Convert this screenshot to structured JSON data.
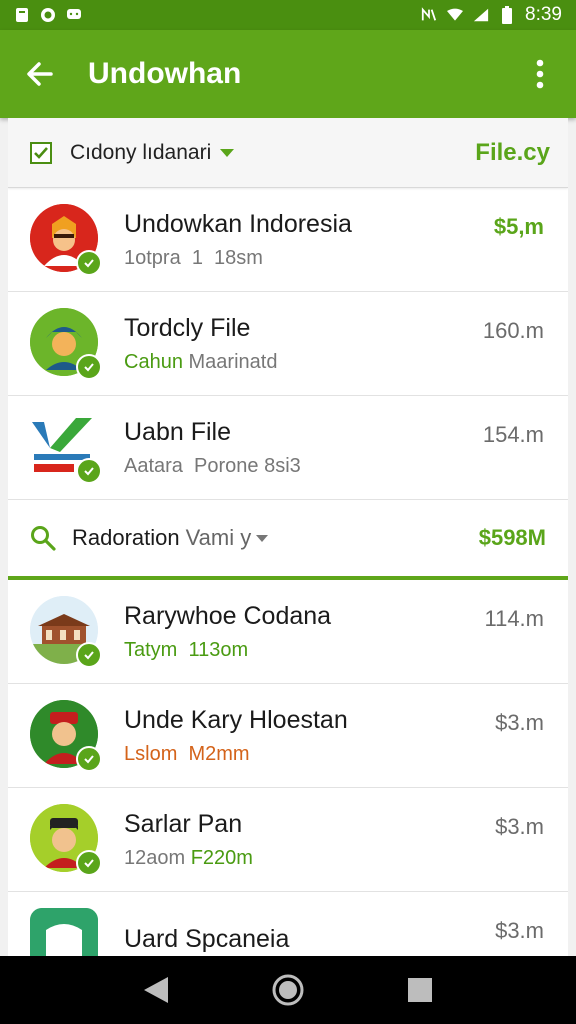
{
  "status_bar": {
    "time": "8:39",
    "left_icons": [
      "notification-icon",
      "whatsapp-icon",
      "message-icon"
    ],
    "right_icons": [
      "nfc-icon",
      "wifi-icon",
      "signal-icon",
      "battery-icon"
    ]
  },
  "app_bar": {
    "title": "Undowhan",
    "back_icon": "back-arrow-icon",
    "menu_icon": "more-vert-icon"
  },
  "filter": {
    "label": "Cıdony lıdanari",
    "action": "File.cy"
  },
  "rows_top": [
    {
      "title": "Undowkan Indoresia",
      "sub": "1otpra  1  18sm",
      "amount": "$5,m",
      "amount_style": "green",
      "sub_style": "gray"
    },
    {
      "title": "Tordcly File",
      "sub_a": "Cahun",
      "sub_b": "Maarinatd",
      "amount": "160.m",
      "amount_style": "gray",
      "sub_style": "mixed"
    },
    {
      "title": "Uabn File",
      "sub": "Aatara  Porone 8si3",
      "amount": "154.m",
      "amount_style": "gray",
      "sub_style": "gray"
    }
  ],
  "section": {
    "label": "Radoration",
    "sub": "Vami y",
    "amount": "$598M"
  },
  "rows_bottom": [
    {
      "title": "Rarywhoe Codana",
      "sub": "Tatym  113om",
      "amount": "114.m",
      "amount_style": "gray",
      "sub_style": "green"
    },
    {
      "title": "Unde Kary Hloestan",
      "sub": "Lslom  M2mm",
      "amount": "$3.m",
      "amount_style": "gray",
      "sub_style": "orange"
    },
    {
      "title": "Sarlar Pan",
      "sub_a": "12aom",
      "sub_b": "F220m",
      "amount": "$3.m",
      "amount_style": "gray",
      "sub_style": "mixed"
    },
    {
      "title": "Uard Spcaneia",
      "sub": "",
      "amount": "$3.m",
      "amount_style": "gray",
      "sub_style": "gray"
    }
  ],
  "colors": {
    "accent": "#5fa61a",
    "status_bar": "#4a8f10",
    "orange": "#d4631a"
  },
  "nav": {
    "back": "nav-back-icon",
    "home": "nav-home-icon",
    "recents": "nav-recents-icon"
  }
}
